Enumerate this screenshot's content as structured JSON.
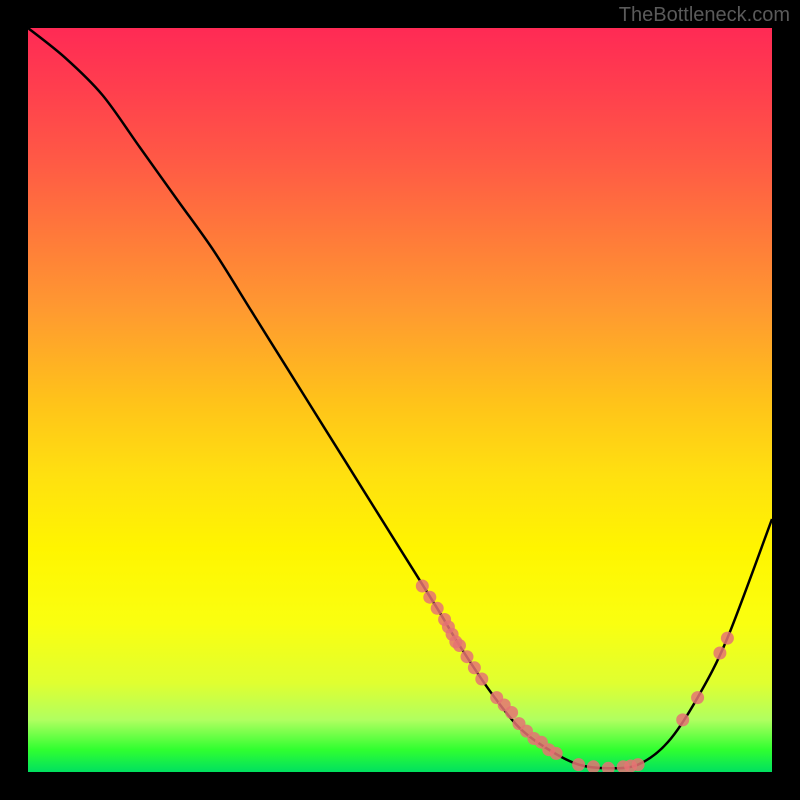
{
  "watermark": "TheBottleneck.com",
  "chart_data": {
    "type": "line",
    "title": "",
    "xlabel": "",
    "ylabel": "",
    "xlim": [
      0,
      100
    ],
    "ylim": [
      0,
      100
    ],
    "series": [
      {
        "name": "bottleneck-curve",
        "x": [
          0,
          5,
          10,
          15,
          20,
          25,
          30,
          35,
          40,
          45,
          50,
          55,
          58,
          62,
          66,
          70,
          74,
          78,
          82,
          86,
          90,
          94,
          100
        ],
        "y": [
          100,
          96,
          91,
          84,
          77,
          70,
          62,
          54,
          46,
          38,
          30,
          22,
          17,
          11,
          6,
          3,
          1,
          0.5,
          1,
          4,
          10,
          18,
          34
        ]
      }
    ],
    "scatter_points": {
      "name": "data-points",
      "x": [
        53,
        54,
        55,
        56,
        56.5,
        57,
        57.5,
        58,
        59,
        60,
        61,
        63,
        64,
        65,
        66,
        67,
        68,
        69,
        70,
        71,
        74,
        76,
        78,
        80,
        81,
        82,
        88,
        90,
        93,
        94
      ],
      "y": [
        25,
        23.5,
        22,
        20.5,
        19.5,
        18.5,
        17.5,
        17,
        15.5,
        14,
        12.5,
        10,
        9,
        8,
        6.5,
        5.5,
        4.5,
        4,
        3,
        2.5,
        1,
        0.7,
        0.5,
        0.7,
        0.8,
        1,
        7,
        10,
        16,
        18
      ]
    },
    "gradient_colors": {
      "top": "#ff2a55",
      "mid_upper": "#ff9a30",
      "mid": "#ffe010",
      "mid_lower": "#faff10",
      "bottom": "#00e060"
    }
  }
}
